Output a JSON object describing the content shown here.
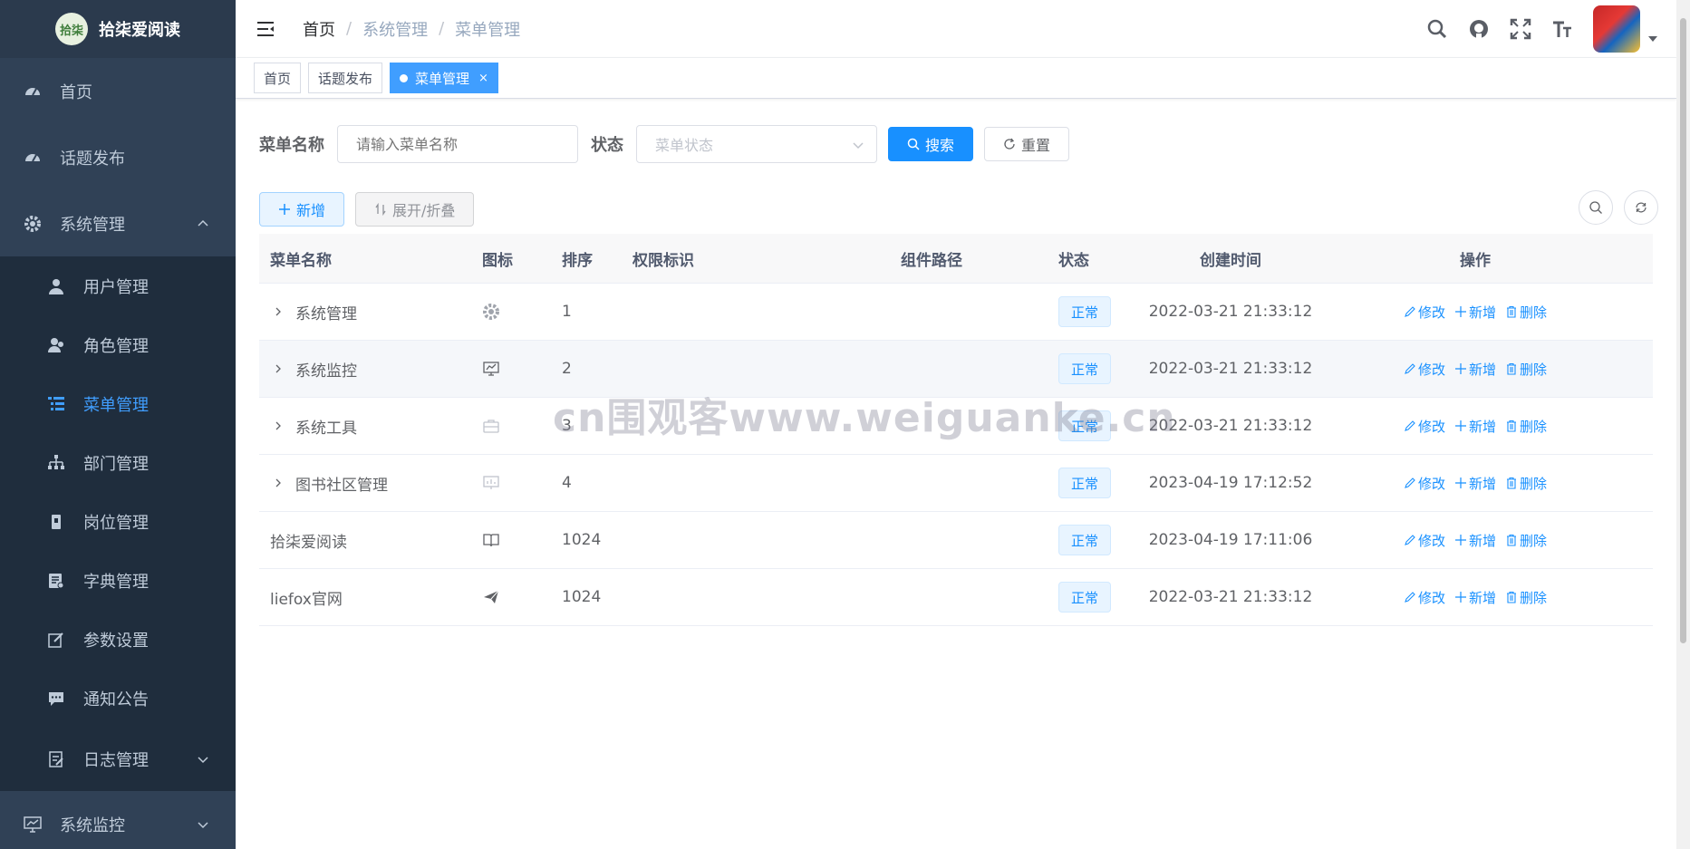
{
  "app": {
    "logo_text": "拾柒",
    "title": "拾柒爱阅读"
  },
  "sidebar": {
    "items": [
      {
        "label": "首页",
        "icon": "dashboard-icon"
      },
      {
        "label": "话题发布",
        "icon": "dashboard-icon"
      },
      {
        "label": "系统管理",
        "icon": "gear-icon",
        "expanded": true,
        "children": [
          {
            "label": "用户管理",
            "icon": "user-icon"
          },
          {
            "label": "角色管理",
            "icon": "peoples-icon"
          },
          {
            "label": "菜单管理",
            "icon": "tree-table-icon",
            "active": true
          },
          {
            "label": "部门管理",
            "icon": "tree-icon"
          },
          {
            "label": "岗位管理",
            "icon": "post-icon"
          },
          {
            "label": "字典管理",
            "icon": "dict-icon"
          },
          {
            "label": "参数设置",
            "icon": "edit-icon"
          },
          {
            "label": "通知公告",
            "icon": "message-icon"
          },
          {
            "label": "日志管理",
            "icon": "log-icon"
          }
        ]
      },
      {
        "label": "系统监控",
        "icon": "monitor-icon"
      }
    ]
  },
  "navbar": {
    "breadcrumb": [
      "首页",
      "系统管理",
      "菜单管理"
    ],
    "breadcrumb_sep": "/"
  },
  "tags": [
    "首页",
    "话题发布",
    "菜单管理"
  ],
  "tag_close": "×",
  "search": {
    "name_label": "菜单名称",
    "name_placeholder": "请输入菜单名称",
    "status_label": "状态",
    "status_placeholder": "菜单状态",
    "search_btn": "搜索",
    "reset_btn": "重置"
  },
  "toolbar": {
    "add_btn": "新增",
    "toggle_btn": "展开/折叠"
  },
  "table": {
    "headers": [
      "菜单名称",
      "图标",
      "排序",
      "权限标识",
      "组件路径",
      "状态",
      "创建时间",
      "操作"
    ],
    "ops": {
      "edit": "修改",
      "add": "新增",
      "delete": "删除"
    },
    "rows": [
      {
        "name": "系统管理",
        "expandable": true,
        "icon": "gear-icon",
        "order": "1",
        "perm": "",
        "path": "",
        "status": "正常",
        "time": "2022-03-21 21:33:12"
      },
      {
        "name": "系统监控",
        "expandable": true,
        "icon": "monitor-icon",
        "order": "2",
        "perm": "",
        "path": "",
        "status": "正常",
        "time": "2022-03-21 21:33:12"
      },
      {
        "name": "系统工具",
        "expandable": true,
        "icon": "toolbox-icon",
        "order": "3",
        "perm": "",
        "path": "",
        "status": "正常",
        "time": "2022-03-21 21:33:12"
      },
      {
        "name": "图书社区管理",
        "expandable": true,
        "icon": "board-icon",
        "order": "4",
        "perm": "",
        "path": "",
        "status": "正常",
        "time": "2023-04-19 17:12:52"
      },
      {
        "name": "拾柒爱阅读",
        "expandable": false,
        "icon": "book-icon",
        "order": "1024",
        "perm": "",
        "path": "",
        "status": "正常",
        "time": "2023-04-19 17:11:06"
      },
      {
        "name": "liefox官网",
        "expandable": false,
        "icon": "paper-plane-icon",
        "order": "1024",
        "perm": "",
        "path": "",
        "status": "正常",
        "time": "2022-03-21 21:33:12"
      }
    ]
  },
  "watermark": "cn围观客www.weiguanke.cn",
  "colors": {
    "sidebar_bg": "#304156",
    "submenu_bg": "#1f2d3d",
    "primary": "#1890ff",
    "active_menu": "#409eff"
  }
}
